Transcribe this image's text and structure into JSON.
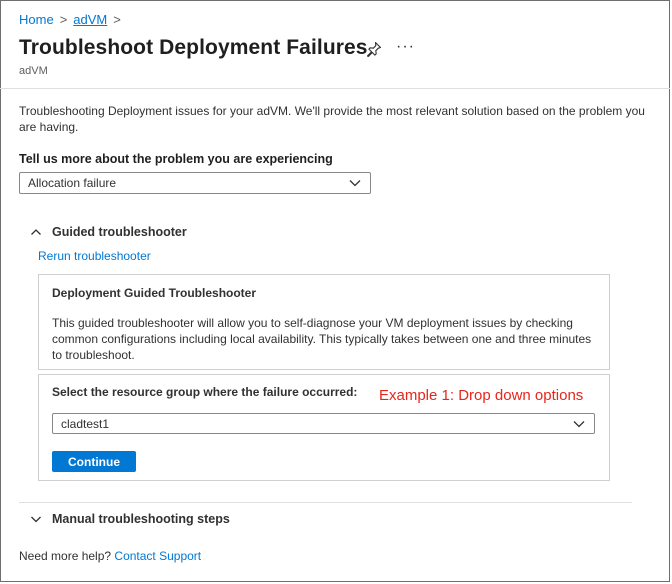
{
  "breadcrumb": {
    "home": "Home",
    "current": "adVM",
    "separator": ">"
  },
  "header": {
    "title": "Troubleshoot Deployment Failures",
    "subtitle": "adVM",
    "more": "···"
  },
  "description": "Troubleshooting Deployment issues for your adVM. We'll provide the most relevant solution based on the problem you are having.",
  "problem": {
    "label": "Tell us more about the problem you are experiencing",
    "selected": "Allocation failure"
  },
  "guided": {
    "header": "Guided troubleshooter",
    "rerun": "Rerun troubleshooter",
    "card_title": "Deployment Guided Troubleshooter",
    "card_body": "This guided troubleshooter will allow you to self-diagnose your VM deployment issues by checking common configurations including local availability. This typically takes between one and three minutes to troubleshoot.",
    "rg_label": "Select the resource group where the failure occurred:",
    "rg_selected": "cladtest1",
    "continue": "Continue"
  },
  "annotation": "Example 1: Drop down options",
  "manual": {
    "header": "Manual troubleshooting steps"
  },
  "help": {
    "text": "Need more help?",
    "link": "Contact Support"
  },
  "colors": {
    "accent": "#0078d4",
    "annotation": "#e8251b"
  },
  "icons": {
    "pin": "pin-icon",
    "chevron": "chevron-down-icon",
    "collapse": "chevron-up-icon"
  }
}
